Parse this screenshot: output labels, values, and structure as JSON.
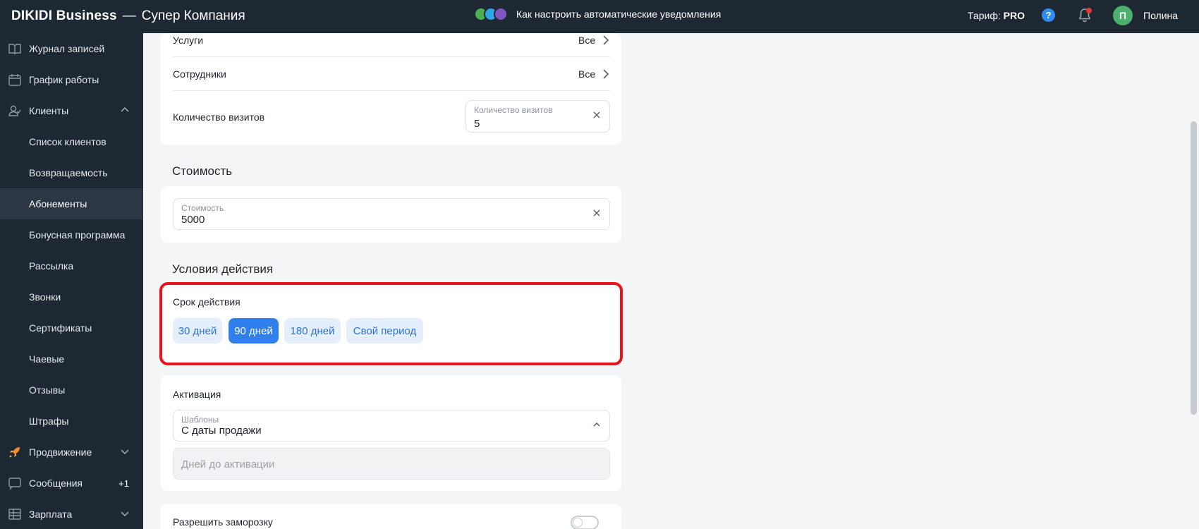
{
  "topbar": {
    "brand_name": "DIKIDI Business",
    "separator": "—",
    "company": "Супер Компания",
    "promo_text": "Как настроить автоматические уведомления",
    "tariff_label": "Тариф:",
    "tariff_value": "PRO",
    "help_glyph": "?",
    "avatar_letter": "П",
    "user_name": "Полина"
  },
  "sidebar": {
    "items": [
      {
        "label": "Журнал записей",
        "icon": "journal-icon"
      },
      {
        "label": "График работы",
        "icon": "calendar-icon"
      },
      {
        "label": "Клиенты",
        "icon": "clients-icon",
        "expanded": true
      },
      {
        "label": "Список клиентов"
      },
      {
        "label": "Возвращаемость"
      },
      {
        "label": "Абонементы",
        "active": true
      },
      {
        "label": "Бонусная программа"
      },
      {
        "label": "Рассылка"
      },
      {
        "label": "Звонки"
      },
      {
        "label": "Сертификаты"
      },
      {
        "label": "Чаевые"
      },
      {
        "label": "Отзывы"
      },
      {
        "label": "Штрафы"
      },
      {
        "label": "Продвижение",
        "icon": "rocket-icon"
      },
      {
        "label": "Сообщения",
        "icon": "messages-icon",
        "badge": "+1"
      },
      {
        "label": "Зарплата",
        "icon": "salary-icon"
      }
    ]
  },
  "filters": {
    "services_label": "Услуги",
    "services_value": "Все",
    "staff_label": "Сотрудники",
    "staff_value": "Все",
    "visits_label": "Количество визитов",
    "visits_field_label": "Количество визитов",
    "visits_field_value": "5"
  },
  "cost": {
    "title": "Стоимость",
    "field_label": "Стоимость",
    "field_value": "5000"
  },
  "conditions": {
    "title": "Условия действия",
    "validity_label": "Срок действия",
    "options": [
      "30 дней",
      "90 дней",
      "180 дней",
      "Свой период"
    ],
    "selected": "90 дней"
  },
  "activation": {
    "title": "Активация",
    "template_label": "Шаблоны",
    "template_value": "С даты продажи",
    "days_placeholder": "Дней до активации"
  },
  "freeze": {
    "label": "Разрешить заморозку",
    "enabled": false
  },
  "colors": {
    "topbar_bg": "#1d2833",
    "accent": "#2f80ed",
    "highlight": "#e8141d"
  }
}
